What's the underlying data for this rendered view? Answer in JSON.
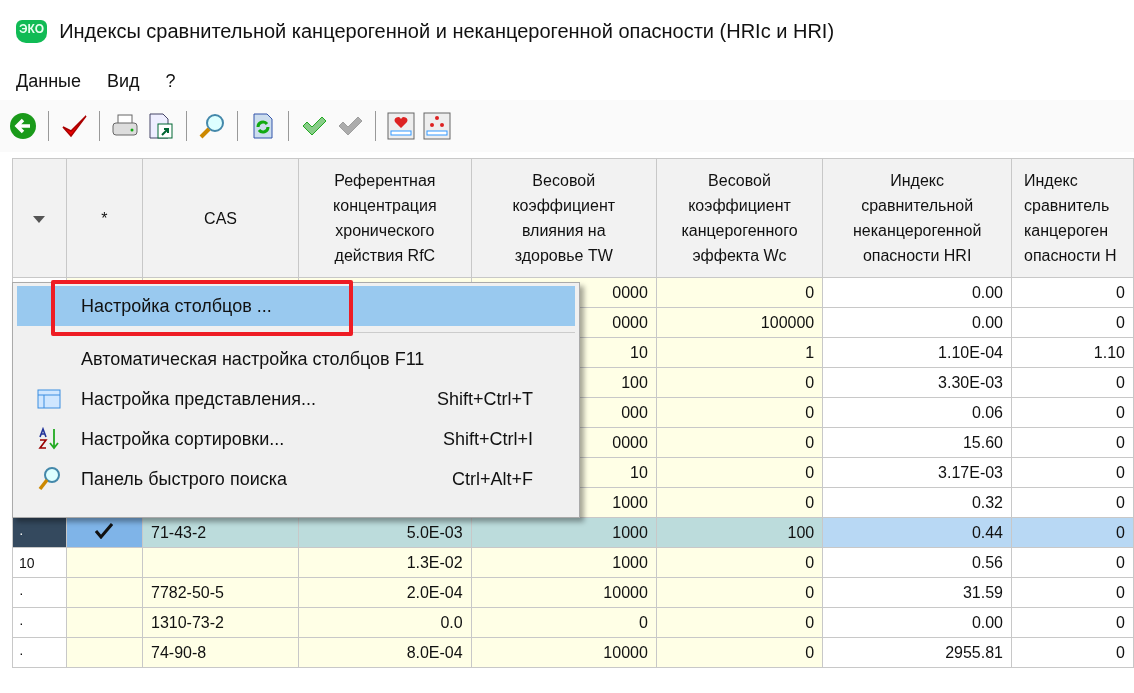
{
  "window": {
    "logo_text": "ЭКО",
    "title": "Индексы сравнительной канцерогенной и неканцерогенной опасности (HRIc и HRI)"
  },
  "menu_bar": [
    "Данные",
    "Вид",
    "?"
  ],
  "toolbar": [
    {
      "kind": "back",
      "disabled": false
    },
    {
      "kind": "separator"
    },
    {
      "kind": "apply",
      "disabled": false
    },
    {
      "kind": "separator"
    },
    {
      "kind": "print",
      "disabled": false
    },
    {
      "kind": "export",
      "disabled": false
    },
    {
      "kind": "separator"
    },
    {
      "kind": "search",
      "disabled": false
    },
    {
      "kind": "separator"
    },
    {
      "kind": "refresh",
      "disabled": false
    },
    {
      "kind": "separator"
    },
    {
      "kind": "check",
      "disabled": false
    },
    {
      "kind": "uncheck",
      "disabled": true
    },
    {
      "kind": "separator"
    },
    {
      "kind": "heart-report",
      "disabled": false
    },
    {
      "kind": "stars-report",
      "disabled": false
    }
  ],
  "table": {
    "columns": [
      "*",
      "CAS",
      "Референтная\nконцентрация\nхронического\nдействия RfC",
      "Весовой\nкоэффициент\nвлияния на\nздоровье TW",
      "Весовой\nкоэффициент\nканцерогенного\nэффекта Wc",
      "Индекс\nсравнительной\nнеканцерогенной\nопасности HRI",
      "Индекс\nсравнитель\nканцероген\nопасности Н"
    ],
    "rows": [
      {
        "checked": false,
        "selected": false,
        "tw": "0000",
        "wc": "0",
        "hri": "0.00",
        "col_8": "0"
      },
      {
        "checked": false,
        "selected": false,
        "tw": "0000",
        "wc": "100000",
        "hri": "0.00",
        "col_8": "0"
      },
      {
        "checked": false,
        "selected": false,
        "tw": "10",
        "wc": "1",
        "hri": "1.10E-04",
        "col_8": "1.10"
      },
      {
        "checked": false,
        "selected": false,
        "tw": "100",
        "wc": "0",
        "hri": "3.30E-03",
        "col_8": "0"
      },
      {
        "checked": false,
        "selected": false,
        "tw": "000",
        "wc": "0",
        "hri": "0.06",
        "col_8": "0"
      },
      {
        "checked": false,
        "selected": false,
        "tw": "0000",
        "wc": "0",
        "hri": "15.60",
        "col_8": "0"
      },
      {
        "checked": false,
        "selected": false,
        "tw": "10",
        "wc": "0",
        "hri": "3.17E-03",
        "col_8": "0"
      },
      {
        "checked": false,
        "selected": false,
        "tw": "1000",
        "wc": "0",
        "hri": "0.32",
        "col_8": "0"
      },
      {
        "indicator": "·",
        "checked": true,
        "selected": true,
        "cas": "71-43-2",
        "rfc": "5.0E-03",
        "tw": "1000",
        "wc": "100",
        "hri": "0.44",
        "col_8": "0"
      },
      {
        "indicator": "10",
        "checked": false,
        "selected": false,
        "rfc": "1.3E-02",
        "tw": "1000",
        "wc": "0",
        "hri": "0.56",
        "col_8": "0"
      },
      {
        "indicator": "·",
        "checked": false,
        "selected": false,
        "cas": "7782-50-5",
        "rfc": "2.0E-04",
        "tw": "10000",
        "wc": "0",
        "hri": "31.59",
        "col_8": "0"
      },
      {
        "indicator": "·",
        "checked": false,
        "selected": false,
        "cas": "1310-73-2",
        "rfc": "0.0",
        "tw": "0",
        "wc": "0",
        "hri": "0.00",
        "col_8": "0"
      },
      {
        "indicator": "·",
        "checked": false,
        "selected": false,
        "cas": "74-90-8",
        "rfc": "8.0E-04",
        "tw": "10000",
        "wc": "0",
        "hri": "2955.81",
        "col_8": "0"
      }
    ]
  },
  "context_menu": {
    "items": [
      {
        "kind": "plain",
        "label": "Настройка столбцов ...",
        "selected": true,
        "outlined": true
      },
      {
        "kind": "separator"
      },
      {
        "kind": "plain",
        "label": "Автоматическая настройка столбцов F11",
        "selected": false,
        "outlined": false
      },
      {
        "kind": "view",
        "label": "Настройка представления...",
        "shortcut": "Shift+Ctrl+T",
        "selected": false,
        "outlined": false
      },
      {
        "kind": "sort",
        "label": "Настройка сортировки...",
        "shortcut": "Shift+Ctrl+I",
        "selected": false,
        "outlined": false
      },
      {
        "kind": "search",
        "label": "Панель быстрого поиска",
        "shortcut": "Ctrl+Alt+F",
        "selected": false,
        "outlined": false
      }
    ]
  }
}
